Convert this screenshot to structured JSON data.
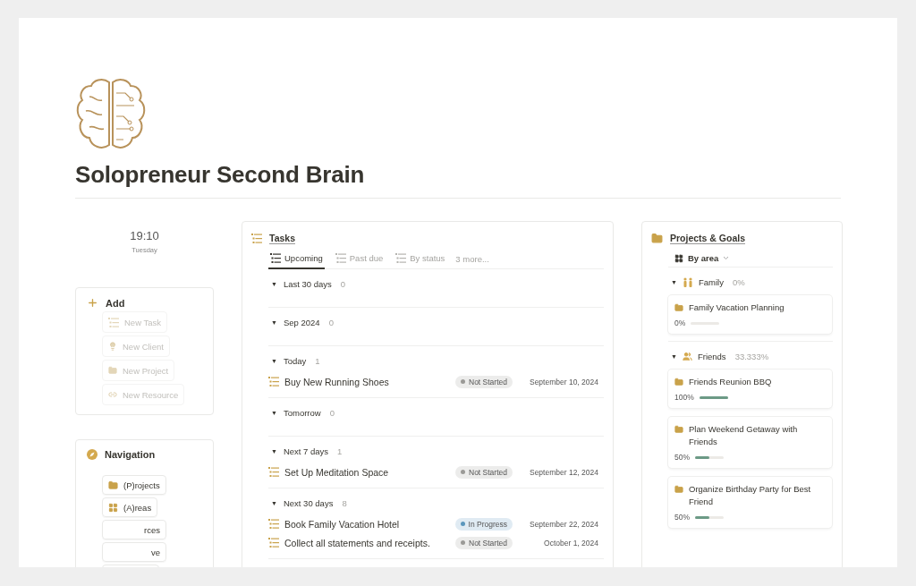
{
  "page": {
    "title": "Solopreneur Second Brain"
  },
  "clock": {
    "time": "19:10",
    "day": "Tuesday"
  },
  "add": {
    "title": "Add",
    "items": [
      {
        "label": "New Task",
        "kind": "task"
      },
      {
        "label": "New Client",
        "kind": "client"
      },
      {
        "label": "New Project",
        "kind": "project"
      },
      {
        "label": "New Resource",
        "kind": "resource"
      }
    ]
  },
  "navigation": {
    "title": "Navigation",
    "items": [
      {
        "label": "(P)rojects",
        "kind": "folder"
      },
      {
        "label": "(A)reas",
        "kind": "grid"
      },
      {
        "label": "rces",
        "kind": "partial"
      },
      {
        "label": "ve",
        "kind": "partial"
      },
      {
        "kind": "stub"
      }
    ]
  },
  "tasks": {
    "title": "Tasks",
    "tabs": [
      {
        "label": "Upcoming",
        "selected": true
      },
      {
        "label": "Past due",
        "selected": false
      },
      {
        "label": "By status",
        "selected": false
      }
    ],
    "more": "3 more...",
    "groups": [
      {
        "arrow": "▼",
        "name": "Last 30 days",
        "count": "0"
      },
      {
        "arrow": "▼",
        "name": "Sep 2024",
        "count": "0"
      },
      {
        "arrow": "▼",
        "name": "Today",
        "count": "1",
        "rows": [
          {
            "name": "Buy New Running Shoes",
            "status": "Not Started",
            "color": "#9b9a97",
            "date": "September 10, 2024"
          }
        ]
      },
      {
        "arrow": "▼",
        "name": "Tomorrow",
        "count": "0"
      },
      {
        "arrow": "▼",
        "name": "Next 7 days",
        "count": "1",
        "rows": [
          {
            "name": "Set Up Meditation Space",
            "status": "Not Started",
            "color": "#9b9a97",
            "date": "September 12, 2024"
          }
        ]
      },
      {
        "arrow": "▼",
        "name": "Next 30 days",
        "count": "8",
        "rows": [
          {
            "name": "Book Family Vacation Hotel",
            "status": "In Progress",
            "color": "#5b97bd",
            "date": "September 22, 2024"
          },
          {
            "name": "Collect all statements and receipts.",
            "status": "Not Started",
            "color": "#9b9a97",
            "date": "October 1, 2024"
          }
        ]
      }
    ]
  },
  "projects": {
    "title": "Projects & Goals",
    "view": "By area",
    "groups": [
      {
        "arrow": "▼",
        "name": "Family",
        "kind": "family",
        "percent": "0%",
        "cards": [
          {
            "name": "Family Vacation Planning",
            "percent": "0%",
            "level": 0
          }
        ]
      },
      {
        "arrow": "▼",
        "name": "Friends",
        "kind": "friends",
        "percent": "33.333%",
        "cards": [
          {
            "name": "Friends Reunion BBQ",
            "percent": "100%",
            "level": 1
          },
          {
            "name": "Plan Weekend Getaway with Friends",
            "percent": "50%",
            "level": 0.5
          },
          {
            "name": "Organize Birthday Party for Best Friend",
            "percent": "50%",
            "level": 0.5
          }
        ]
      }
    ]
  }
}
